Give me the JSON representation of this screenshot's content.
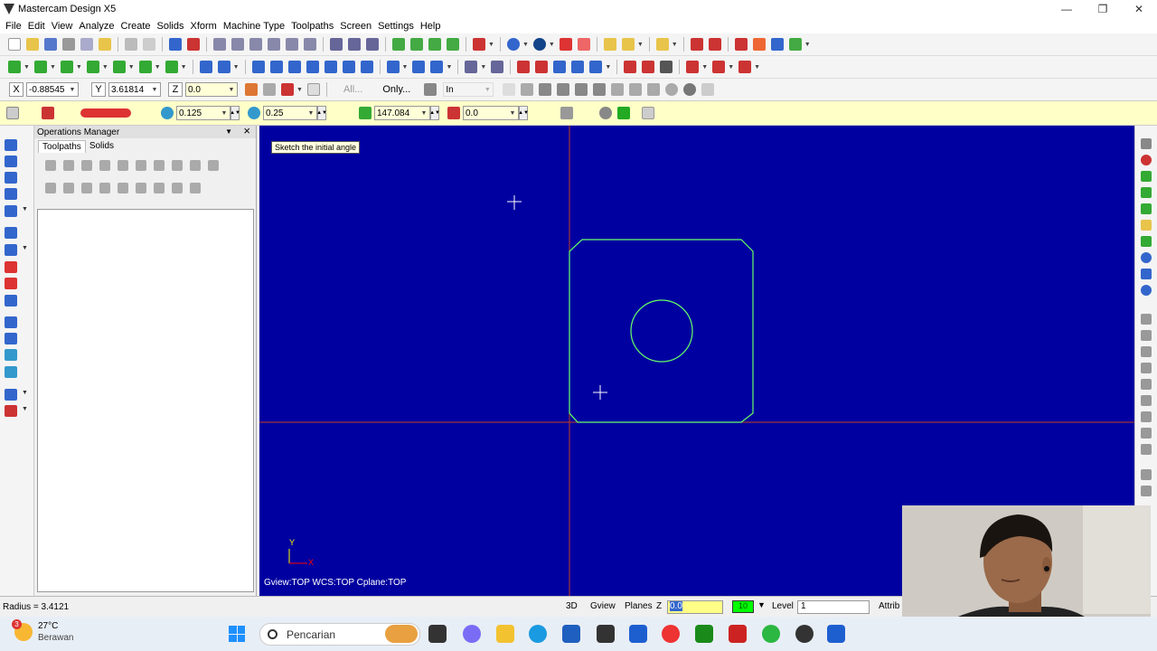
{
  "window": {
    "title": "Mastercam Design X5"
  },
  "menu": [
    "File",
    "Edit",
    "View",
    "Analyze",
    "Create",
    "Solids",
    "Xform",
    "Machine Type",
    "Toolpaths",
    "Screen",
    "Settings",
    "Help"
  ],
  "coords": {
    "x_label": "X",
    "x_value": "-0.88545",
    "y_label": "Y",
    "y_value": "3.61814",
    "z_label": "Z",
    "z_value": "0.0",
    "all_label": "All...",
    "only_label": "Only...",
    "units": "In"
  },
  "ribbon": {
    "field1": "0.125",
    "field2": "0.25",
    "angle": "147.084",
    "angle2": "0.0"
  },
  "ops": {
    "title": "Operations Manager",
    "tabs": [
      "Toolpaths",
      "Solids"
    ]
  },
  "viewport": {
    "tooltip": "Sketch the initial angle",
    "status": "Gview:TOP   WCS:TOP   Cplane:TOP",
    "axis_y": "Y",
    "axis_x": "X"
  },
  "status": {
    "radius": "Radius = 3.4121",
    "mode3d": "3D",
    "gview": "Gview",
    "planes": "Planes",
    "z_label": "Z",
    "z_value": "0.0",
    "color": "10",
    "level_label": "Level",
    "level_value": "1",
    "attrib": "Attrib"
  },
  "taskbar": {
    "temp": "27°C",
    "weather": "Berawan",
    "badge": "3",
    "search": "Pencarian"
  },
  "colors": {
    "viewport_bg": "#0000a0",
    "geometry": "#66ff66",
    "ribbon_bg": "#ffffc8"
  }
}
